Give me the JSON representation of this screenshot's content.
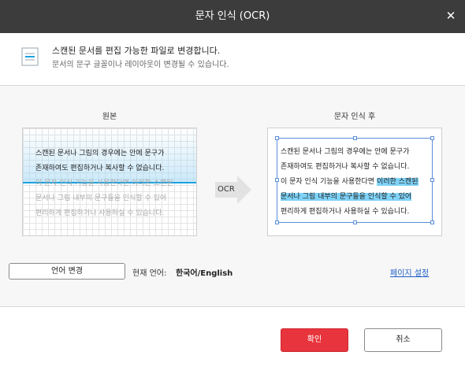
{
  "window": {
    "title": "문자 인식 (OCR)",
    "close_glyph": "✕"
  },
  "info": {
    "icon": "document-icon",
    "title": "스캔된 문서를 편집 가능한 파일로 변경합니다.",
    "subtitle": "문서의 문구 글꼴이나 레이아웃이 변경될 수 있습니다."
  },
  "preview": {
    "original_label": "원본",
    "after_label": "문자 인식 후",
    "arrow_label": "OCR",
    "original_lines": [
      "스캔된 문서나 그림의 경우에는 안에 문구가",
      "존재하여도 편집하거나 복사할 수 없습니다.",
      "이 문자 인식 기능을 사용한다면 이러한 스캔된",
      "문서나 그림 내부의 문구들을 인식할 수 있어",
      "편리하게 편집하거나 사용하실 수 있습니다."
    ],
    "after_lines": {
      "l1": "스캔된 문서나 그림의 경우에는 안에 문구가",
      "l2": "존재하여도 편집하거나 복사할 수 없습니다.",
      "l3_plain": "이 문자 인식 기능을 사용한다면 ",
      "l3_highlight": "이러한 스캔된",
      "l4_highlight": "문서나 그림 내부의 문구들을 인식할 수 있어",
      "l5": "편리하게 편집하거나 사용하실 수 있습니다."
    },
    "highlight_color": "#7fd3f8"
  },
  "language": {
    "change_button": "언어 변경",
    "current_label": "현재 언어:",
    "current_value": "한국어/English"
  },
  "page_setting_link": "페이지 설정",
  "footer": {
    "ok_button": "확인",
    "cancel_button": "취소",
    "ok_color": "#e8343c"
  }
}
